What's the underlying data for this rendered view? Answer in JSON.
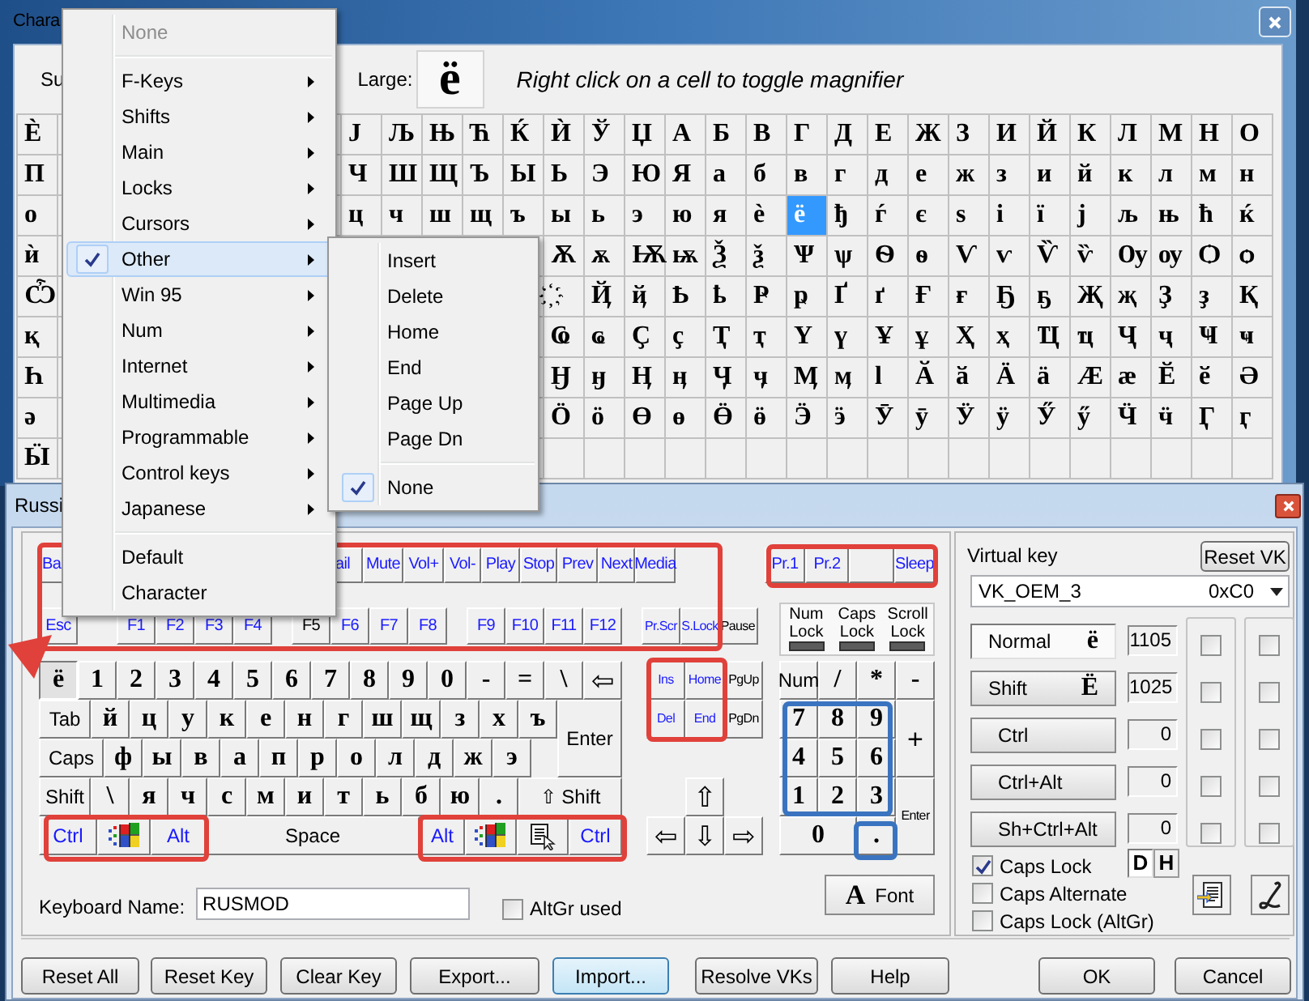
{
  "char_map": {
    "title": "Chara",
    "subset_label": "Su",
    "large_label": "Large:",
    "large_char": "ё",
    "hint": "Right click on a cell to toggle magnifier",
    "grid": [
      {
        "cells": [
          {
            "char": "Ѐ",
            "selected": false
          },
          null,
          null,
          null,
          null,
          null,
          null,
          null,
          {
            "char": "Ј",
            "selected": false
          },
          {
            "char": "Љ",
            "selected": false
          },
          {
            "char": "Њ",
            "selected": false
          },
          {
            "char": "Ћ",
            "selected": false
          },
          {
            "char": "Ќ",
            "selected": false
          },
          {
            "char": "Ѝ",
            "selected": false
          },
          {
            "char": "Ў",
            "selected": false
          },
          {
            "char": "Џ",
            "selected": false
          },
          {
            "char": "А",
            "selected": false
          },
          {
            "char": "Б",
            "selected": false
          },
          {
            "char": "В",
            "selected": false
          },
          {
            "char": "Г",
            "selected": false
          },
          {
            "char": "Д",
            "selected": false
          },
          {
            "char": "Е",
            "selected": false
          },
          {
            "char": "Ж",
            "selected": false
          },
          {
            "char": "З",
            "selected": false
          },
          {
            "char": "И",
            "selected": false
          },
          {
            "char": "Й",
            "selected": false
          },
          {
            "char": "К",
            "selected": false
          },
          {
            "char": "Л",
            "selected": false
          },
          {
            "char": "М",
            "selected": false
          },
          {
            "char": "Н",
            "selected": false
          },
          {
            "char": "О",
            "selected": false
          }
        ]
      },
      {
        "cells": [
          {
            "char": "П",
            "selected": false
          },
          null,
          null,
          null,
          null,
          null,
          null,
          null,
          {
            "char": "Ч",
            "selected": false
          },
          {
            "char": "Ш",
            "selected": false
          },
          {
            "char": "Щ",
            "selected": false
          },
          {
            "char": "Ъ",
            "selected": false
          },
          {
            "char": "Ы",
            "selected": false
          },
          {
            "char": "Ь",
            "selected": false
          },
          {
            "char": "Э",
            "selected": false
          },
          {
            "char": "Ю",
            "selected": false
          },
          {
            "char": "Я",
            "selected": false
          },
          {
            "char": "а",
            "selected": false
          },
          {
            "char": "б",
            "selected": false
          },
          {
            "char": "в",
            "selected": false
          },
          {
            "char": "г",
            "selected": false
          },
          {
            "char": "д",
            "selected": false
          },
          {
            "char": "е",
            "selected": false
          },
          {
            "char": "ж",
            "selected": false
          },
          {
            "char": "з",
            "selected": false
          },
          {
            "char": "и",
            "selected": false
          },
          {
            "char": "й",
            "selected": false
          },
          {
            "char": "к",
            "selected": false
          },
          {
            "char": "л",
            "selected": false
          },
          {
            "char": "м",
            "selected": false
          },
          {
            "char": "н",
            "selected": false
          }
        ]
      },
      {
        "cells": [
          {
            "char": "о",
            "selected": false
          },
          null,
          null,
          null,
          null,
          null,
          null,
          null,
          {
            "char": "ц",
            "selected": false
          },
          {
            "char": "ч",
            "selected": false
          },
          {
            "char": "ш",
            "selected": false
          },
          {
            "char": "щ",
            "selected": false
          },
          {
            "char": "ъ",
            "selected": false
          },
          {
            "char": "ы",
            "selected": false
          },
          {
            "char": "ь",
            "selected": false
          },
          {
            "char": "э",
            "selected": false
          },
          {
            "char": "ю",
            "selected": false
          },
          {
            "char": "я",
            "selected": false
          },
          {
            "char": "ѐ",
            "selected": false
          },
          {
            "char": "ё",
            "selected": true
          },
          {
            "char": "ђ",
            "selected": false
          },
          {
            "char": "ѓ",
            "selected": false
          },
          {
            "char": "є",
            "selected": false
          },
          {
            "char": "ѕ",
            "selected": false
          },
          {
            "char": "і",
            "selected": false
          },
          {
            "char": "ї",
            "selected": false
          },
          {
            "char": "ј",
            "selected": false
          },
          {
            "char": "љ",
            "selected": false
          },
          {
            "char": "њ",
            "selected": false
          },
          {
            "char": "ћ",
            "selected": false
          },
          {
            "char": "ќ",
            "selected": false
          }
        ]
      },
      {
        "cells": [
          {
            "char": "ѝ",
            "selected": false
          },
          null,
          null,
          null,
          null,
          null,
          null,
          null,
          null,
          null,
          null,
          null,
          null,
          {
            "char": "Ѫ",
            "selected": false
          },
          {
            "char": "ѫ",
            "selected": false
          },
          {
            "char": "Ѭ",
            "selected": false
          },
          {
            "char": "ѭ",
            "selected": false
          },
          {
            "char": "Ѯ",
            "selected": false
          },
          {
            "char": "ѯ",
            "selected": false
          },
          {
            "char": "Ѱ",
            "selected": false
          },
          {
            "char": "ѱ",
            "selected": false
          },
          {
            "char": "Ѳ",
            "selected": false
          },
          {
            "char": "ѳ",
            "selected": false
          },
          {
            "char": "Ѵ",
            "selected": false
          },
          {
            "char": "ѵ",
            "selected": false
          },
          {
            "char": "Ѷ",
            "selected": false
          },
          {
            "char": "ѷ",
            "selected": false
          },
          {
            "char": "Ѹ",
            "selected": false
          },
          {
            "char": "ѹ",
            "selected": false
          },
          {
            "char": "Ѻ",
            "selected": false
          },
          {
            "char": "ѻ",
            "selected": false
          }
        ]
      },
      {
        "cells": [
          {
            "char": "Ѽ",
            "selected": false
          },
          null,
          null,
          null,
          null,
          null,
          null,
          null,
          null,
          null,
          null,
          null,
          null,
          {
            "char": "҉",
            "selected": false
          },
          {
            "char": "Ҋ",
            "selected": false
          },
          {
            "char": "ҋ",
            "selected": false
          },
          {
            "char": "Ҍ",
            "selected": false
          },
          {
            "char": "ҍ",
            "selected": false
          },
          {
            "char": "Ҏ",
            "selected": false
          },
          {
            "char": "ҏ",
            "selected": false
          },
          {
            "char": "Ґ",
            "selected": false
          },
          {
            "char": "ґ",
            "selected": false
          },
          {
            "char": "Ғ",
            "selected": false
          },
          {
            "char": "ғ",
            "selected": false
          },
          {
            "char": "Ҕ",
            "selected": false
          },
          {
            "char": "ҕ",
            "selected": false
          },
          {
            "char": "Җ",
            "selected": false
          },
          {
            "char": "җ",
            "selected": false
          },
          {
            "char": "Ҙ",
            "selected": false
          },
          {
            "char": "ҙ",
            "selected": false
          },
          {
            "char": "Қ",
            "selected": false
          }
        ]
      },
      {
        "cells": [
          {
            "char": "қ",
            "selected": false
          },
          null,
          null,
          null,
          null,
          null,
          null,
          null,
          null,
          null,
          null,
          null,
          null,
          {
            "char": "Ҩ",
            "selected": false
          },
          {
            "char": "ҩ",
            "selected": false
          },
          {
            "char": "Ҫ",
            "selected": false
          },
          {
            "char": "ҫ",
            "selected": false
          },
          {
            "char": "Ҭ",
            "selected": false
          },
          {
            "char": "ҭ",
            "selected": false
          },
          {
            "char": "Ү",
            "selected": false
          },
          {
            "char": "ү",
            "selected": false
          },
          {
            "char": "Ұ",
            "selected": false
          },
          {
            "char": "ұ",
            "selected": false
          },
          {
            "char": "Ҳ",
            "selected": false
          },
          {
            "char": "ҳ",
            "selected": false
          },
          {
            "char": "Ҵ",
            "selected": false
          },
          {
            "char": "ҵ",
            "selected": false
          },
          {
            "char": "Ҷ",
            "selected": false
          },
          {
            "char": "ҷ",
            "selected": false
          },
          {
            "char": "Ҹ",
            "selected": false
          },
          {
            "char": "ҹ",
            "selected": false
          }
        ]
      },
      {
        "cells": [
          {
            "char": "Һ",
            "selected": false
          },
          null,
          null,
          null,
          null,
          null,
          null,
          null,
          null,
          null,
          null,
          null,
          null,
          {
            "char": "Ӈ",
            "selected": false
          },
          {
            "char": "ӈ",
            "selected": false
          },
          {
            "char": "Ӊ",
            "selected": false
          },
          {
            "char": "ӊ",
            "selected": false
          },
          {
            "char": "Ӌ",
            "selected": false
          },
          {
            "char": "ӌ",
            "selected": false
          },
          {
            "char": "Ӎ",
            "selected": false
          },
          {
            "char": "ӎ",
            "selected": false
          },
          {
            "char": "ӏ",
            "selected": false
          },
          {
            "char": "Ӑ",
            "selected": false
          },
          {
            "char": "ӑ",
            "selected": false
          },
          {
            "char": "Ӓ",
            "selected": false
          },
          {
            "char": "ӓ",
            "selected": false
          },
          {
            "char": "Ӕ",
            "selected": false
          },
          {
            "char": "ӕ",
            "selected": false
          },
          {
            "char": "Ӗ",
            "selected": false
          },
          {
            "char": "ӗ",
            "selected": false
          },
          {
            "char": "Ә",
            "selected": false
          }
        ]
      },
      {
        "cells": [
          {
            "char": "ә",
            "selected": false
          },
          null,
          null,
          null,
          null,
          null,
          null,
          null,
          null,
          null,
          null,
          null,
          null,
          {
            "char": "Ӧ",
            "selected": false
          },
          {
            "char": "ӧ",
            "selected": false
          },
          {
            "char": "Ө",
            "selected": false
          },
          {
            "char": "ө",
            "selected": false
          },
          {
            "char": "Ӫ",
            "selected": false
          },
          {
            "char": "ӫ",
            "selected": false
          },
          {
            "char": "Ӭ",
            "selected": false
          },
          {
            "char": "ӭ",
            "selected": false
          },
          {
            "char": "Ӯ",
            "selected": false
          },
          {
            "char": "ӯ",
            "selected": false
          },
          {
            "char": "Ӱ",
            "selected": false
          },
          {
            "char": "ӱ",
            "selected": false
          },
          {
            "char": "Ӳ",
            "selected": false
          },
          {
            "char": "ӳ",
            "selected": false
          },
          {
            "char": "Ӵ",
            "selected": false
          },
          {
            "char": "ӵ",
            "selected": false
          },
          {
            "char": "Ӷ",
            "selected": false
          },
          {
            "char": "ӷ",
            "selected": false
          }
        ]
      },
      {
        "cells": [
          {
            "char": "Ӹ",
            "selected": false
          },
          null,
          null,
          null,
          null,
          null,
          null,
          null,
          null,
          null,
          null,
          null,
          null,
          null,
          null,
          null,
          null,
          null,
          null,
          null,
          null,
          null,
          null,
          null,
          null,
          null,
          null,
          null,
          null,
          null,
          null
        ]
      }
    ]
  },
  "popup_menu": {
    "items": [
      {
        "kind": "item",
        "label": "None",
        "disabled": true,
        "checked": false,
        "selected": false,
        "submenu": false
      },
      {
        "kind": "separator"
      },
      {
        "kind": "item",
        "label": "F-Keys",
        "disabled": false,
        "checked": false,
        "selected": false,
        "submenu": true
      },
      {
        "kind": "item",
        "label": "Shifts",
        "disabled": false,
        "checked": false,
        "selected": false,
        "submenu": true
      },
      {
        "kind": "item",
        "label": "Main",
        "disabled": false,
        "checked": false,
        "selected": false,
        "submenu": true
      },
      {
        "kind": "item",
        "label": "Locks",
        "disabled": false,
        "checked": false,
        "selected": false,
        "submenu": true
      },
      {
        "kind": "item",
        "label": "Cursors",
        "disabled": false,
        "checked": false,
        "selected": false,
        "submenu": true
      },
      {
        "kind": "item",
        "label": "Other",
        "disabled": false,
        "checked": true,
        "selected": true,
        "submenu": true
      },
      {
        "kind": "item",
        "label": "Win 95",
        "disabled": false,
        "checked": false,
        "selected": false,
        "submenu": true
      },
      {
        "kind": "item",
        "label": "Num",
        "disabled": false,
        "checked": false,
        "selected": false,
        "submenu": true
      },
      {
        "kind": "item",
        "label": "Internet",
        "disabled": false,
        "checked": false,
        "selected": false,
        "submenu": true
      },
      {
        "kind": "item",
        "label": "Multimedia",
        "disabled": false,
        "checked": false,
        "selected": false,
        "submenu": true
      },
      {
        "kind": "item",
        "label": "Programmable",
        "disabled": false,
        "checked": false,
        "selected": false,
        "submenu": true
      },
      {
        "kind": "item",
        "label": "Control keys",
        "disabled": false,
        "checked": false,
        "selected": false,
        "submenu": true
      },
      {
        "kind": "item",
        "label": "Japanese",
        "disabled": false,
        "checked": false,
        "selected": false,
        "submenu": true
      },
      {
        "kind": "separator"
      },
      {
        "kind": "item",
        "label": "Default",
        "disabled": false,
        "checked": false,
        "selected": false,
        "submenu": false
      },
      {
        "kind": "item",
        "label": "Character",
        "disabled": false,
        "checked": false,
        "selected": false,
        "submenu": false
      }
    ]
  },
  "submenu": {
    "items": [
      {
        "kind": "item",
        "label": "Insert",
        "disabled": false,
        "checked": false,
        "selected": false,
        "submenu": false
      },
      {
        "kind": "item",
        "label": "Delete",
        "disabled": false,
        "checked": false,
        "selected": false,
        "submenu": false
      },
      {
        "kind": "item",
        "label": "Home",
        "disabled": false,
        "checked": false,
        "selected": false,
        "submenu": false
      },
      {
        "kind": "item",
        "label": "End",
        "disabled": false,
        "checked": false,
        "selected": false,
        "submenu": false
      },
      {
        "kind": "item",
        "label": "Page Up",
        "disabled": false,
        "checked": false,
        "selected": false,
        "submenu": false
      },
      {
        "kind": "item",
        "label": "Page Dn",
        "disabled": false,
        "checked": false,
        "selected": false,
        "submenu": false
      },
      {
        "kind": "separator"
      },
      {
        "kind": "item",
        "label": "None",
        "disabled": false,
        "checked": true,
        "selected": false,
        "submenu": false
      }
    ]
  },
  "keyboard_window": {
    "title": "Russi",
    "media_keys": [
      {
        "label": "Ba",
        "kind": "small",
        "remapped": true,
        "selected": false
      },
      {
        "label": "ail",
        "kind": "small",
        "remapped": true,
        "selected": false
      },
      {
        "label": "Mute",
        "kind": "small",
        "remapped": true,
        "selected": false
      },
      {
        "label": "Vol+",
        "kind": "small",
        "remapped": true,
        "selected": false
      },
      {
        "label": "Vol-",
        "kind": "small",
        "remapped": true,
        "selected": false
      },
      {
        "label": "Play",
        "kind": "small",
        "remapped": true,
        "selected": false
      },
      {
        "label": "Stop",
        "kind": "small",
        "remapped": true,
        "selected": false
      },
      {
        "label": "Prev",
        "kind": "small",
        "remapped": true,
        "selected": false
      },
      {
        "label": "Next",
        "kind": "small",
        "remapped": true,
        "selected": false
      },
      {
        "label": "Media",
        "kind": "small",
        "remapped": true,
        "selected": false
      }
    ],
    "program_keys": [
      {
        "label": "Pr.1",
        "kind": "small",
        "remapped": true,
        "selected": false
      },
      {
        "label": "Pr.2",
        "kind": "small",
        "remapped": true,
        "selected": false
      },
      {
        "kind": "blank",
        "selected": false
      },
      {
        "label": "Sleep",
        "kind": "small",
        "remapped": true,
        "selected": false
      }
    ],
    "esc_key": {
      "label": "Esc",
      "kind": "small",
      "remapped": true,
      "selected": false
    },
    "f_keys": [
      {
        "label": "F1",
        "kind": "small",
        "remapped": true,
        "selected": false
      },
      {
        "label": "F2",
        "kind": "small",
        "remapped": true,
        "selected": false
      },
      {
        "label": "F3",
        "kind": "small",
        "remapped": true,
        "selected": false
      },
      {
        "label": "F4",
        "kind": "small",
        "remapped": true,
        "selected": false
      },
      {
        "label": "F5",
        "kind": "small",
        "remapped": false,
        "selected": false
      },
      {
        "label": "F6",
        "kind": "small",
        "remapped": true,
        "selected": false
      },
      {
        "label": "F7",
        "kind": "small",
        "remapped": true,
        "selected": false
      },
      {
        "label": "F8",
        "kind": "small",
        "remapped": true,
        "selected": false
      },
      {
        "label": "F9",
        "kind": "small",
        "remapped": true,
        "selected": false
      },
      {
        "label": "F10",
        "kind": "small",
        "remapped": true,
        "selected": false
      },
      {
        "label": "F11",
        "kind": "small",
        "remapped": true,
        "selected": false
      },
      {
        "label": "F12",
        "kind": "small",
        "remapped": true,
        "selected": false
      }
    ],
    "system_keys": [
      {
        "label": "Pr.Scr",
        "kind": "tiny",
        "remapped": true,
        "selected": false
      },
      {
        "label": "S.Lock",
        "kind": "tiny",
        "remapped": true,
        "selected": false
      },
      {
        "label": "Pause",
        "kind": "tiny",
        "remapped": false,
        "selected": false
      }
    ],
    "lock_indicators": [
      {
        "label": "Num Lock",
        "on": false
      },
      {
        "label": "Caps Lock",
        "on": false
      },
      {
        "label": "Scroll Lock",
        "on": false
      }
    ],
    "main_rows": [
      {
        "keys": [
          {
            "label": "ё",
            "kind": "char",
            "remapped": false,
            "selected": true
          },
          {
            "label": "1",
            "kind": "char",
            "remapped": false,
            "selected": false
          },
          {
            "label": "2",
            "kind": "char",
            "remapped": false,
            "selected": false
          },
          {
            "label": "3",
            "kind": "char",
            "remapped": false,
            "selected": false
          },
          {
            "label": "4",
            "kind": "char",
            "remapped": false,
            "selected": false
          },
          {
            "label": "5",
            "kind": "char",
            "remapped": false,
            "selected": false
          },
          {
            "label": "6",
            "kind": "char",
            "remapped": false,
            "selected": false
          },
          {
            "label": "7",
            "kind": "char",
            "remapped": false,
            "selected": false
          },
          {
            "label": "8",
            "kind": "char",
            "remapped": false,
            "selected": false
          },
          {
            "label": "9",
            "kind": "char",
            "remapped": false,
            "selected": false
          },
          {
            "label": "0",
            "kind": "char",
            "remapped": false,
            "selected": false
          },
          {
            "label": "-",
            "kind": "char",
            "remapped": false,
            "selected": false
          },
          {
            "label": "=",
            "kind": "char",
            "remapped": false,
            "selected": false
          },
          {
            "label": "\\",
            "kind": "char",
            "remapped": false,
            "selected": false
          },
          {
            "label": "⇦",
            "kind": "arrow",
            "remapped": false,
            "selected": false
          }
        ]
      },
      {
        "keys": [
          {
            "label": "Tab",
            "kind": "name",
            "remapped": false,
            "selected": false
          },
          {
            "label": "й",
            "kind": "char",
            "remapped": false,
            "selected": false
          },
          {
            "label": "ц",
            "kind": "char",
            "remapped": false,
            "selected": false
          },
          {
            "label": "у",
            "kind": "char",
            "remapped": false,
            "selected": false
          },
          {
            "label": "к",
            "kind": "char",
            "remapped": false,
            "selected": false
          },
          {
            "label": "е",
            "kind": "char",
            "remapped": false,
            "selected": false
          },
          {
            "label": "н",
            "kind": "char",
            "remapped": false,
            "selected": false
          },
          {
            "label": "г",
            "kind": "char",
            "remapped": false,
            "selected": false
          },
          {
            "label": "ш",
            "kind": "char",
            "remapped": false,
            "selected": false
          },
          {
            "label": "щ",
            "kind": "char",
            "remapped": false,
            "selected": false
          },
          {
            "label": "з",
            "kind": "char",
            "remapped": false,
            "selected": false
          },
          {
            "label": "х",
            "kind": "char",
            "remapped": false,
            "selected": false
          },
          {
            "label": "ъ",
            "kind": "char",
            "remapped": false,
            "selected": false
          },
          {
            "label": "Enter",
            "kind": "name",
            "remapped": false,
            "selected": false
          }
        ]
      },
      {
        "keys": [
          {
            "label": "Caps",
            "kind": "name",
            "remapped": false,
            "selected": false
          },
          {
            "label": "ф",
            "kind": "char",
            "remapped": false,
            "selected": false
          },
          {
            "label": "ы",
            "kind": "char",
            "remapped": false,
            "selected": false
          },
          {
            "label": "в",
            "kind": "char",
            "remapped": false,
            "selected": false
          },
          {
            "label": "а",
            "kind": "char",
            "remapped": false,
            "selected": false
          },
          {
            "label": "п",
            "kind": "char",
            "remapped": false,
            "selected": false
          },
          {
            "label": "р",
            "kind": "char",
            "remapped": false,
            "selected": false
          },
          {
            "label": "о",
            "kind": "char",
            "remapped": false,
            "selected": false
          },
          {
            "label": "л",
            "kind": "char",
            "remapped": false,
            "selected": false
          },
          {
            "label": "д",
            "kind": "char",
            "remapped": false,
            "selected": false
          },
          {
            "label": "ж",
            "kind": "char",
            "remapped": false,
            "selected": false
          },
          {
            "label": "э",
            "kind": "char",
            "remapped": false,
            "selected": false
          }
        ]
      },
      {
        "keys": [
          {
            "label": "Shift",
            "kind": "name",
            "remapped": false,
            "selected": false
          },
          {
            "label": "\\",
            "kind": "char",
            "remapped": false,
            "selected": false
          },
          {
            "label": "я",
            "kind": "char",
            "remapped": false,
            "selected": false
          },
          {
            "label": "ч",
            "kind": "char",
            "remapped": false,
            "selected": false
          },
          {
            "label": "с",
            "kind": "char",
            "remapped": false,
            "selected": false
          },
          {
            "label": "м",
            "kind": "char",
            "remapped": false,
            "selected": false
          },
          {
            "label": "и",
            "kind": "char",
            "remapped": false,
            "selected": false
          },
          {
            "label": "т",
            "kind": "char",
            "remapped": false,
            "selected": false
          },
          {
            "label": "ь",
            "kind": "char",
            "remapped": false,
            "selected": false
          },
          {
            "label": "б",
            "kind": "char",
            "remapped": false,
            "selected": false
          },
          {
            "label": "ю",
            "kind": "char",
            "remapped": false,
            "selected": false
          },
          {
            "label": ".",
            "kind": "char",
            "remapped": false,
            "selected": false
          },
          {
            "label": "⇧ Shift",
            "kind": "name",
            "remapped": false,
            "selected": false
          }
        ]
      },
      {
        "keys": [
          {
            "label": "Ctrl",
            "kind": "name",
            "remapped": true,
            "selected": false
          },
          {
            "kind": "win",
            "selected": false
          },
          {
            "label": "Alt",
            "kind": "name",
            "remapped": true,
            "selected": false
          },
          {
            "label": "Space",
            "kind": "name",
            "remapped": false,
            "selected": false
          },
          {
            "label": "Alt",
            "kind": "name",
            "remapped": true,
            "selected": false
          },
          {
            "kind": "win",
            "selected": false
          },
          {
            "kind": "menu",
            "selected": false
          },
          {
            "label": "Ctrl",
            "kind": "name",
            "remapped": true,
            "selected": false
          }
        ]
      }
    ],
    "nav_keys": [
      {
        "label": "Ins",
        "kind": "tiny",
        "remapped": true,
        "selected": false
      },
      {
        "label": "Home",
        "kind": "tiny",
        "remapped": true,
        "selected": false
      },
      {
        "label": "PgUp",
        "kind": "tiny",
        "remapped": false,
        "selected": false
      },
      {
        "label": "Del",
        "kind": "tiny",
        "remapped": true,
        "selected": false
      },
      {
        "label": "End",
        "kind": "tiny",
        "remapped": true,
        "selected": false
      },
      {
        "label": "PgDn",
        "kind": "tiny",
        "remapped": false,
        "selected": false
      }
    ],
    "arrow_keys": [
      {
        "label": "⇧",
        "kind": "arrow",
        "remapped": false,
        "selected": false
      },
      {
        "label": "⇦",
        "kind": "arrow",
        "remapped": false,
        "selected": false
      },
      {
        "label": "⇩",
        "kind": "arrow",
        "remapped": false,
        "selected": false
      },
      {
        "label": "⇨",
        "kind": "arrow",
        "remapped": false,
        "selected": false
      }
    ],
    "numpad_keys": [
      {
        "label": "Num",
        "kind": "name",
        "remapped": false,
        "selected": false
      },
      {
        "label": "/",
        "kind": "char",
        "remapped": false,
        "selected": false
      },
      {
        "label": "*",
        "kind": "char",
        "remapped": false,
        "selected": false
      },
      {
        "label": "-",
        "kind": "char",
        "remapped": false,
        "selected": false
      },
      {
        "label": "7",
        "kind": "char",
        "remapped": false,
        "selected": false
      },
      {
        "label": "8",
        "kind": "char",
        "remapped": false,
        "selected": false
      },
      {
        "label": "9",
        "kind": "char",
        "remapped": false,
        "selected": false
      },
      {
        "label": "+",
        "kind": "arrow",
        "remapped": false,
        "selected": false
      },
      {
        "label": "4",
        "kind": "char",
        "remapped": false,
        "selected": false
      },
      {
        "label": "5",
        "kind": "char",
        "remapped": false,
        "selected": false
      },
      {
        "label": "6",
        "kind": "char",
        "remapped": false,
        "selected": false
      },
      {
        "label": "1",
        "kind": "char",
        "remapped": false,
        "selected": false
      },
      {
        "label": "2",
        "kind": "char",
        "remapped": false,
        "selected": false
      },
      {
        "label": "3",
        "kind": "char",
        "remapped": false,
        "selected": false
      },
      {
        "label": "Enter",
        "kind": "tiny",
        "remapped": false,
        "selected": false
      },
      {
        "label": "0",
        "kind": "char",
        "remapped": false,
        "selected": false
      },
      {
        "label": ".",
        "kind": "char",
        "remapped": false,
        "selected": false
      }
    ],
    "keyboard_name_label": "Keyboard Name:",
    "keyboard_name": "RUSMOD",
    "altgr": {
      "label": "AltGr used",
      "checked": false
    },
    "font_button": {
      "letter": "A",
      "label": "Font"
    },
    "virtual_key": {
      "label": "Virtual key",
      "reset_button": "Reset VK",
      "name": "VK_OEM_3",
      "code": "0xC0",
      "shift_states": [
        {
          "label": "Normal",
          "glyph": "ё",
          "value": "1105",
          "selected": true
        },
        {
          "label": "Shift",
          "glyph": "Ё",
          "value": "1025",
          "selected": false
        },
        {
          "label": "Ctrl",
          "value": "0",
          "selected": false
        },
        {
          "label": "Ctrl+Alt",
          "value": "0",
          "selected": false
        },
        {
          "label": "Sh+Ctrl+Alt",
          "value": "0",
          "selected": false
        }
      ],
      "check_columns": [
        {
          "checks": [
            {
              "checked": false
            },
            {
              "checked": false
            },
            {
              "checked": false
            },
            {
              "checked": false
            },
            {
              "checked": false
            }
          ]
        },
        {
          "checks": [
            {
              "checked": false
            },
            {
              "checked": false
            },
            {
              "checked": false
            },
            {
              "checked": false
            },
            {
              "checked": false
            }
          ]
        }
      ],
      "caps_options": [
        {
          "label": "Caps Lock",
          "checked": true
        },
        {
          "label": "Caps Alternate",
          "checked": false
        },
        {
          "label": "Caps Lock (AltGr)",
          "checked": false
        }
      ],
      "mode_buttons": [
        {
          "label": "D",
          "selected": true
        },
        {
          "label": "H",
          "selected": false
        }
      ]
    },
    "buttons": [
      {
        "label": "Reset All",
        "focused": false
      },
      {
        "label": "Reset Key",
        "focused": false
      },
      {
        "label": "Clear Key",
        "focused": false
      },
      {
        "label": "Export...",
        "focused": false
      },
      {
        "label": "Import...",
        "focused": true
      },
      {
        "label": "Resolve VKs",
        "focused": false
      },
      {
        "label": "Help",
        "focused": false
      }
    ],
    "dialog_buttons": [
      {
        "label": "OK",
        "focused": false
      },
      {
        "label": "Cancel",
        "focused": false
      }
    ]
  }
}
